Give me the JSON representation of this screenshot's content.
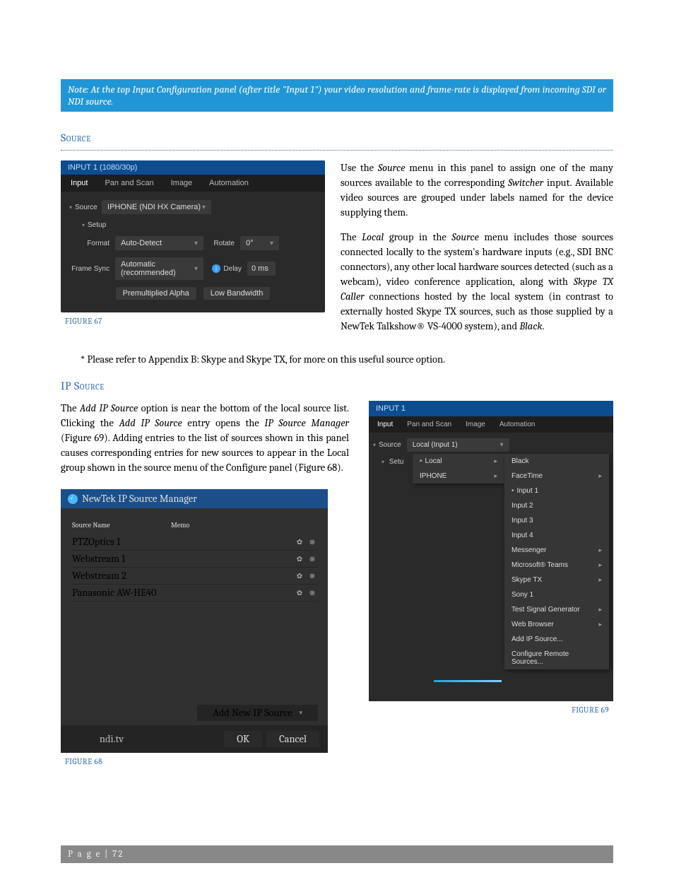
{
  "note": "Note:  At the top Input Configuration panel (after title \"Input 1\") your video resolution and frame-rate is displayed from incoming SDI or NDI source.",
  "section1": "Source",
  "section2": "IP Source",
  "para1a": "Use the ",
  "para1b": "Source",
  "para1c": " menu in this panel to assign one of the many sources available to the corresponding ",
  "para1d": "Switcher",
  "para1e": " input.  Available video sources are grouped under labels named for the device supplying them.",
  "para2a": "The ",
  "para2b": "Local",
  "para2c": " group in the ",
  "para2d": "Source",
  "para2e": " menu includes those sources connected locally to the system's hardware inputs (e.g., SDI BNC connectors), any other local hardware sources detected (such as a webcam), video conference application, along with ",
  "para2f": "Skype TX Caller",
  "para2g": " connections hosted by the local system (in contrast to externally hosted Skype TX sources, such as those supplied by a NewTek Talkshow",
  "para2h": " VS-4000 system), and ",
  "para2i": "Black",
  "para2j": ".",
  "star": "* Please refer to Appendix B: Skype and Skype TX, for more on this useful source option.",
  "ip1a": "The ",
  "ip1b": "Add IP Source",
  "ip1c": " option is near the bottom of the local source list.  Clicking the ",
  "ip1d": "Add IP Source",
  "ip1e": " entry opens the ",
  "ip1f": "IP Source Manager",
  "ip1g": " (Figure 69). Adding entries to the list of sources shown in this panel causes corresponding entries for new sources to appear in the Local group shown in the source menu of the Configure panel (Figure 68).",
  "cap67": "FIGURE 67",
  "cap68": "FIGURE 68",
  "cap69": "FIGURE 69",
  "footer": "P a g e  | 72",
  "f67": {
    "title": "INPUT 1 (1080/30p)",
    "tabs": {
      "input": "Input",
      "pan": "Pan and Scan",
      "image": "Image",
      "auto": "Automation"
    },
    "source_lbl": "Source",
    "source_val": "IPHONE (NDI HX Camera)",
    "setup_lbl": "Setup",
    "format_lbl": "Format",
    "format_val": "Auto-Detect",
    "rotate_lbl": "Rotate",
    "rotate_val": "0°",
    "fs_lbl": "Frame Sync",
    "fs_val": "Automatic (recommended)",
    "delay_lbl": "Delay",
    "delay_val": "0 ms",
    "pma": "Premultiplied Alpha",
    "lbw": "Low Bandwidth"
  },
  "f68": {
    "title": "NewTek IP Source Manager",
    "h1": "Source Name",
    "h2": "Memo",
    "rows": [
      "PTZOptics 1",
      "Webstream 1",
      "Webstream 2",
      "Panasonic AW-HE40"
    ],
    "add": "Add New IP Source",
    "url": "ndi.tv",
    "ok": "OK",
    "cancel": "Cancel"
  },
  "f69": {
    "title": "INPUT 1",
    "tabs": {
      "input": "Input",
      "pan": "Pan and Scan",
      "image": "Image",
      "auto": "Automation"
    },
    "source_lbl": "Source",
    "source_val": "Local (Input 1)",
    "setup_lbl": "Setu",
    "menu1": {
      "local": "Local",
      "iphone": "IPHONE"
    },
    "menu2": {
      "black": "Black",
      "facetime": "FaceTime",
      "i1": "Input 1",
      "i2": "Input 2",
      "i3": "Input 3",
      "i4": "Input 4",
      "msg": "Messenger",
      "teams": "Microsoft® Teams",
      "skype": "Skype TX",
      "sony": "Sony 1",
      "tsg": "Test Signal Generator",
      "web": "Web Browser",
      "addip": "Add IP Source...",
      "crs": "Configure Remote Sources..."
    }
  }
}
